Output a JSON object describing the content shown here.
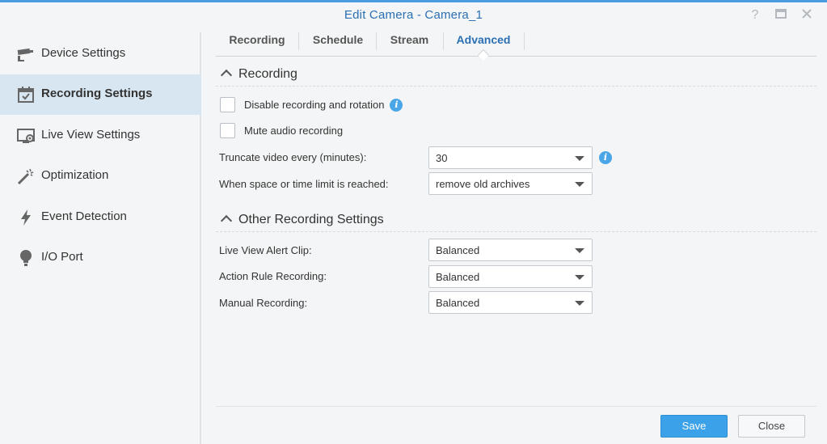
{
  "window": {
    "title": "Edit Camera - Camera_1"
  },
  "sidebar": {
    "items": [
      {
        "label": "Device Settings",
        "icon": "camera-icon"
      },
      {
        "label": "Recording Settings",
        "icon": "calendar-check-icon",
        "active": true
      },
      {
        "label": "Live View Settings",
        "icon": "monitor-icon"
      },
      {
        "label": "Optimization",
        "icon": "magic-wand-icon"
      },
      {
        "label": "Event Detection",
        "icon": "lightning-icon"
      },
      {
        "label": "I/O Port",
        "icon": "lightbulb-icon"
      }
    ]
  },
  "tabs": [
    {
      "label": "Recording"
    },
    {
      "label": "Schedule"
    },
    {
      "label": "Stream"
    },
    {
      "label": "Advanced",
      "active": true
    }
  ],
  "recording": {
    "heading": "Recording",
    "disable_label": "Disable recording and rotation",
    "disable_checked": false,
    "mute_label": "Mute audio recording",
    "mute_checked": false,
    "truncate_label": "Truncate video every (minutes):",
    "truncate_value": "30",
    "limit_label": "When space or time limit is reached:",
    "limit_value": "remove old archives"
  },
  "other": {
    "heading": "Other Recording Settings",
    "alert_label": "Live View Alert Clip:",
    "alert_value": "Balanced",
    "action_label": "Action Rule Recording:",
    "action_value": "Balanced",
    "manual_label": "Manual Recording:",
    "manual_value": "Balanced"
  },
  "footer": {
    "save_label": "Save",
    "close_label": "Close"
  },
  "colors": {
    "accent": "#2a6fb3",
    "primary_button": "#3ba1e8",
    "active_sidebar": "#d8e6f1",
    "info": "#4ba6e8"
  }
}
